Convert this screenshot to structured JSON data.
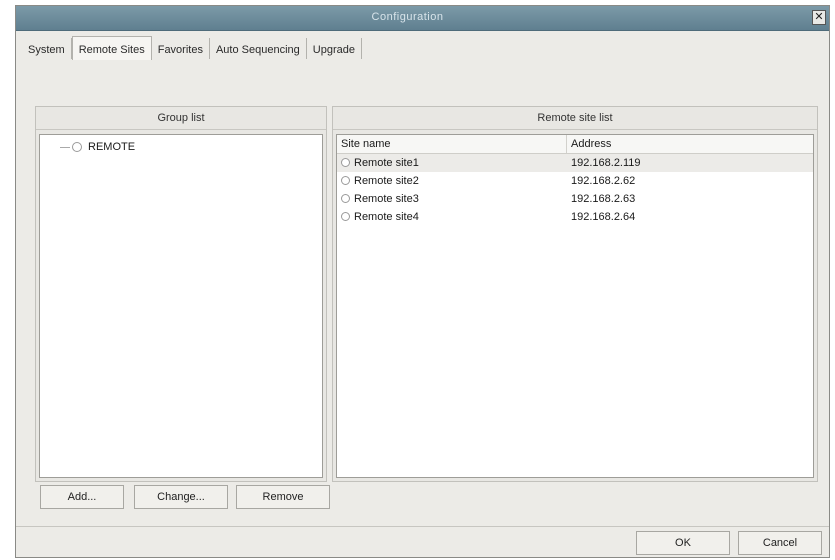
{
  "window": {
    "title": "Configuration",
    "close_glyph": "✕"
  },
  "tabs": [
    {
      "label": "System"
    },
    {
      "label": "Remote Sites"
    },
    {
      "label": "Favorites"
    },
    {
      "label": "Auto Sequencing"
    },
    {
      "label": "Upgrade"
    }
  ],
  "active_tab": "Remote Sites",
  "group_list": {
    "header": "Group list",
    "nodes": [
      {
        "label": "REMOTE"
      }
    ]
  },
  "site_list": {
    "header": "Remote site list",
    "columns": [
      "Site name",
      "Address"
    ],
    "rows": [
      {
        "name": "Remote site1",
        "address": "192.168.2.119"
      },
      {
        "name": "Remote site2",
        "address": "192.168.2.62"
      },
      {
        "name": "Remote site3",
        "address": "192.168.2.63"
      },
      {
        "name": "Remote site4",
        "address": "192.168.2.64"
      }
    ]
  },
  "buttons": {
    "add": "Add...",
    "change": "Change...",
    "remove": "Remove",
    "ok": "OK",
    "cancel": "Cancel"
  },
  "colors": {
    "titlebar": "#6f8d9d",
    "window_bg": "#ecebe7",
    "list_bg": "#ffffff"
  }
}
